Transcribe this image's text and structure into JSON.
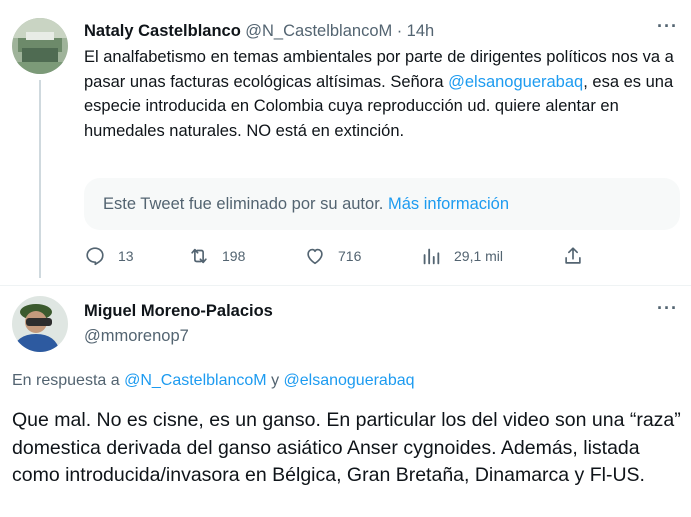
{
  "tweet1": {
    "author_name": "Nataly Castelblanco",
    "author_handle": "@N_CastelblancoM",
    "separator": "·",
    "time": "14h",
    "text_part1": "El analfabetismo en temas ambientales por parte de dirigentes políticos nos va a pasar unas facturas ecológicas altísimas. Señora ",
    "mention": "@elsanoguerabaq",
    "text_part2": ", esa es una especie introducida en Colombia cuya reproducción ud. quiere alentar en humedales naturales. NO está en extinción.",
    "quoted_deleted": "Este Tweet fue eliminado por su autor.",
    "quoted_link": "Más información",
    "replies": "13",
    "retweets": "198",
    "likes": "716",
    "views": "29,1 mil"
  },
  "tweet2": {
    "author_name": "Miguel Moreno-Palacios",
    "author_handle": "@mmorenop7",
    "reply_prefix": "En respuesta a",
    "reply_mention1": "@N_CastelblancoM",
    "reply_conj": "y",
    "reply_mention2": "@elsanoguerabaq",
    "text": "Que mal. No es cisne, es un ganso. En particular los del video son una “raza” domestica derivada del ganso asiático Anser cygnoides. Además, listada como introducida/invasora en Bélgica, Gran Bretaña, Dinamarca y Fl-US."
  },
  "icons": {
    "more": "···",
    "reply": "reply-icon",
    "retweet": "retweet-icon",
    "like": "heart-icon",
    "views": "views-icon",
    "share": "share-icon"
  },
  "colors": {
    "text": "#0f1419",
    "secondary": "#536471",
    "accent": "#1d9bf0"
  }
}
